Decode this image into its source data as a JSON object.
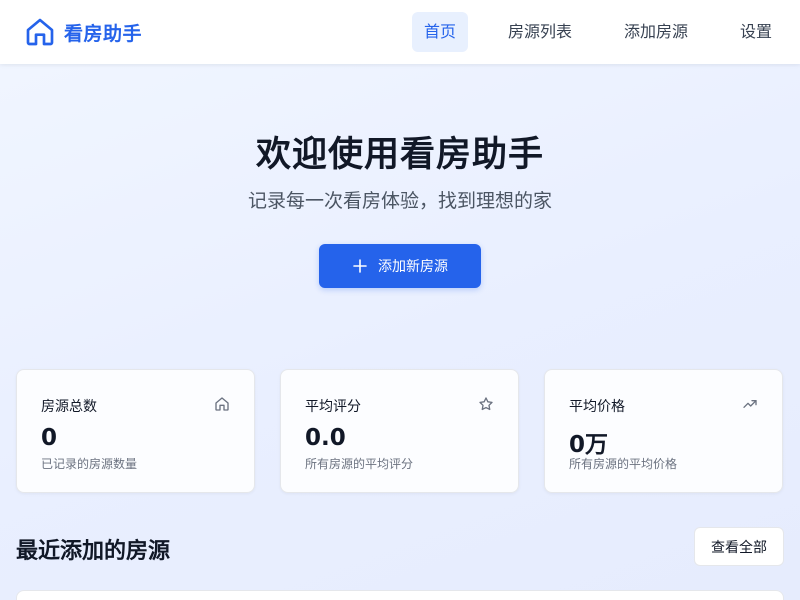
{
  "header": {
    "app_name": "看房助手",
    "nav": [
      {
        "label": "首页",
        "active": true
      },
      {
        "label": "房源列表",
        "active": false
      },
      {
        "label": "添加房源",
        "active": false
      },
      {
        "label": "设置",
        "active": false
      }
    ]
  },
  "hero": {
    "title": "欢迎使用看房助手",
    "subtitle": "记录每一次看房体验，找到理想的家",
    "cta_label": "添加新房源",
    "cta_icon": "plus-icon"
  },
  "stats": [
    {
      "label": "房源总数",
      "value": "0",
      "desc": "已记录的房源数量",
      "icon": "home-icon"
    },
    {
      "label": "平均评分",
      "value": "0.0",
      "desc": "所有房源的平均评分",
      "icon": "star-icon"
    },
    {
      "label": "平均价格",
      "value": "0万",
      "desc": "所有房源的平均价格",
      "icon": "trending-up-icon"
    }
  ],
  "recent": {
    "title": "最近添加的房源",
    "view_all_label": "查看全部"
  },
  "colors": {
    "accent": "#2563eb",
    "accent_light": "#e8f0fe"
  }
}
